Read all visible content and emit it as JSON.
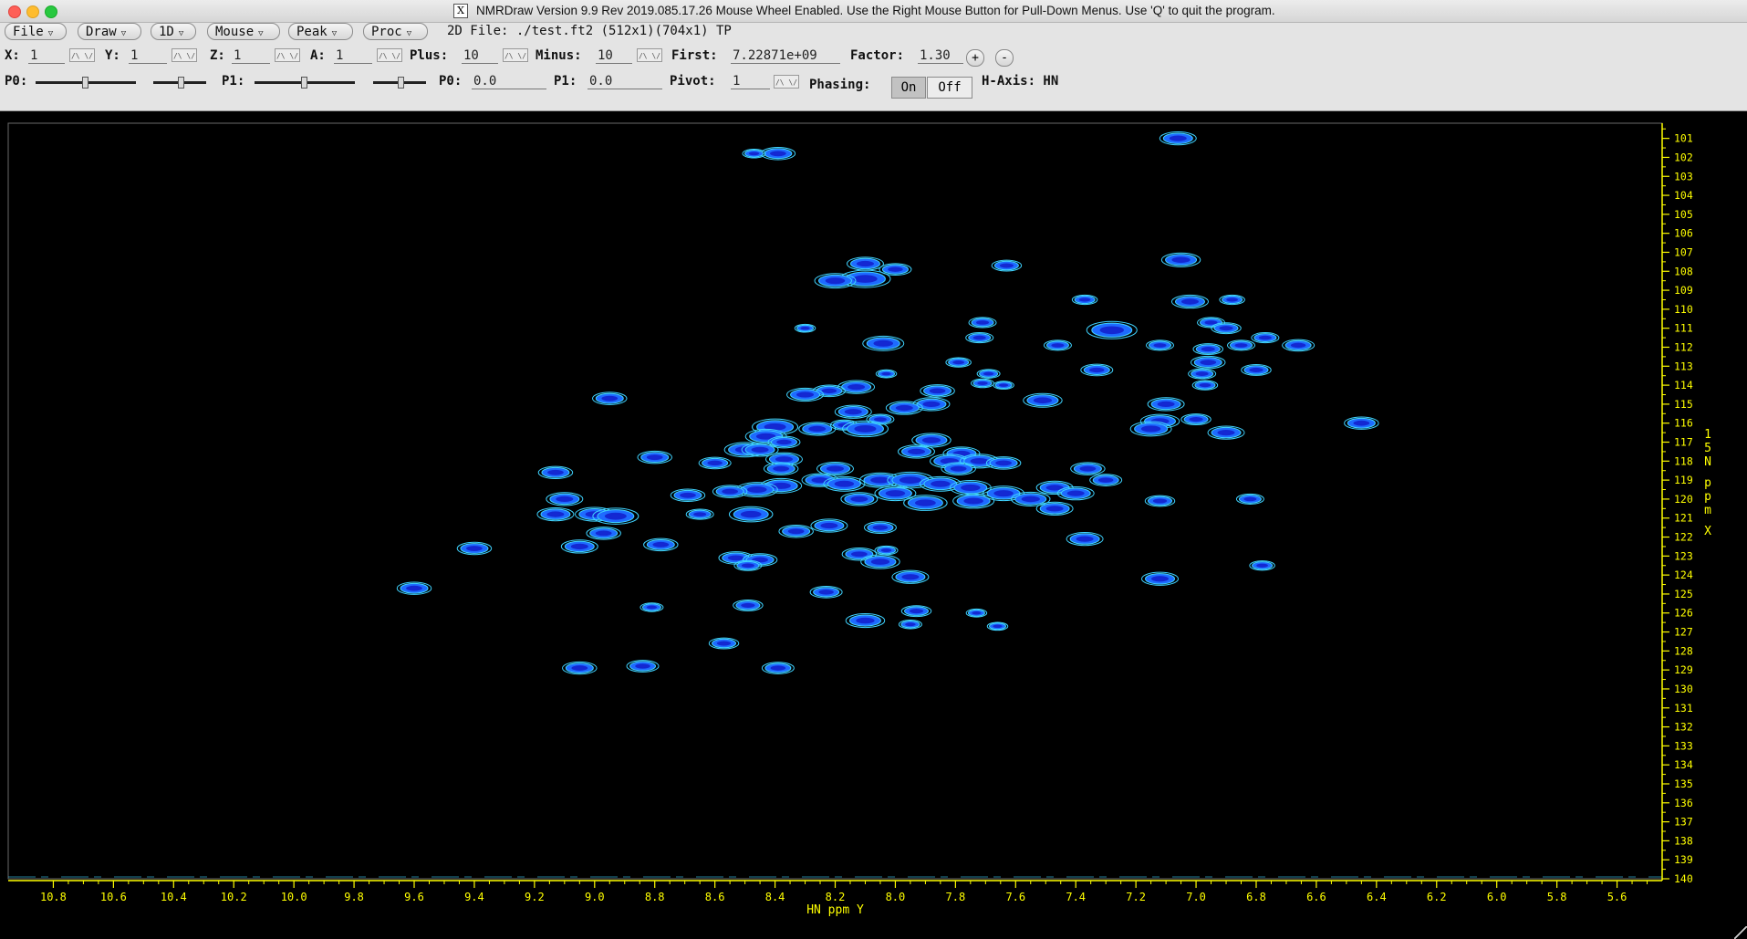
{
  "window": {
    "title": "NMRDraw Version 9.9 Rev 2019.085.17.26   Mouse Wheel Enabled.   Use the Right Mouse Button for Pull-Down Menus.   Use 'Q' to quit the program."
  },
  "menubar": {
    "file": "File",
    "draw": "Draw",
    "oned": "1D",
    "mouse": "Mouse",
    "peak": "Peak",
    "proc": "Proc",
    "file_info": "2D File: ./test.ft2 (512x1)(704x1) TP"
  },
  "row1": {
    "x_label": "X:",
    "x_value": "1",
    "y_label": "Y:",
    "y_value": "1",
    "z_label": "Z:",
    "z_value": "1",
    "a_label": "A:",
    "a_value": "1",
    "plus_label": "Plus:",
    "plus_value": "10",
    "minus_label": "Minus:",
    "minus_value": "10",
    "first_label": "First:",
    "first_value": "7.22871e+09",
    "factor_label": "Factor:",
    "factor_value": "1.30",
    "plus_btn": "+",
    "minus_btn": "-"
  },
  "row2": {
    "p0_slider_label": "P0:",
    "p1_slider_label": "P1:",
    "p0_label": "P0:",
    "p0_value": "0.0",
    "p1_label": "P1:",
    "p1_value": "0.0",
    "pivot_label": "Pivot:",
    "pivot_value": "1",
    "phasing_label": "Phasing:",
    "phasing_on": "On",
    "phasing_off": "Off",
    "haxis_label": "H-Axis: HN"
  },
  "colors": {
    "plot_bg": "#000000",
    "axis": "#ffff00",
    "contour_outer": "#3fd3ff",
    "contour_mid": "#1e6bff",
    "contour_inner": "#1428d2"
  },
  "chart_data": {
    "type": "scatter",
    "description_kind": "2D NMR contour plot (HSQC)",
    "xlabel": "HN ppm Y",
    "ylabel": "15N ppm X",
    "xlim": [
      10.95,
      5.45
    ],
    "ylim": [
      100.2,
      140.0
    ],
    "xticks": [
      "10.8",
      "10.6",
      "10.4",
      "10.2",
      "10.0",
      "9.8",
      "9.6",
      "9.4",
      "9.2",
      "9.0",
      "8.8",
      "8.6",
      "8.4",
      "8.2",
      "8.0",
      "7.8",
      "7.6",
      "7.4",
      "7.2",
      "7.0",
      "6.8",
      "6.6",
      "6.4",
      "6.2",
      "6.0",
      "5.8",
      "5.6"
    ],
    "yticks": [
      "101",
      "102",
      "103",
      "104",
      "105",
      "106",
      "107",
      "108",
      "109",
      "110",
      "111",
      "112",
      "113",
      "114",
      "115",
      "116",
      "117",
      "118",
      "119",
      "120",
      "121",
      "122",
      "123",
      "124",
      "125",
      "126",
      "127",
      "128",
      "129",
      "130",
      "131",
      "132",
      "133",
      "134",
      "135",
      "136",
      "137",
      "138",
      "139",
      "140"
    ],
    "peaks": [
      {
        "x": 7.06,
        "y": 101.0,
        "s": 1.0
      },
      {
        "x": 8.39,
        "y": 101.8,
        "s": 0.9
      },
      {
        "x": 8.47,
        "y": 101.8,
        "s": 0.4
      },
      {
        "x": 8.1,
        "y": 107.6,
        "s": 1.0
      },
      {
        "x": 8.0,
        "y": 107.9,
        "s": 0.8
      },
      {
        "x": 8.1,
        "y": 108.4,
        "s": 1.6
      },
      {
        "x": 8.2,
        "y": 108.5,
        "s": 1.2
      },
      {
        "x": 7.63,
        "y": 107.7,
        "s": 0.7
      },
      {
        "x": 7.05,
        "y": 107.4,
        "s": 1.1
      },
      {
        "x": 7.37,
        "y": 109.5,
        "s": 0.5
      },
      {
        "x": 7.02,
        "y": 109.6,
        "s": 1.0
      },
      {
        "x": 6.88,
        "y": 109.5,
        "s": 0.5
      },
      {
        "x": 7.71,
        "y": 110.7,
        "s": 0.6
      },
      {
        "x": 6.95,
        "y": 110.7,
        "s": 0.6
      },
      {
        "x": 7.28,
        "y": 111.1,
        "s": 1.6
      },
      {
        "x": 6.9,
        "y": 111.0,
        "s": 0.7
      },
      {
        "x": 8.04,
        "y": 111.8,
        "s": 1.2
      },
      {
        "x": 7.72,
        "y": 111.5,
        "s": 0.6
      },
      {
        "x": 7.46,
        "y": 111.9,
        "s": 0.6
      },
      {
        "x": 7.12,
        "y": 111.9,
        "s": 0.6
      },
      {
        "x": 6.96,
        "y": 112.1,
        "s": 0.7
      },
      {
        "x": 6.85,
        "y": 111.9,
        "s": 0.6
      },
      {
        "x": 6.77,
        "y": 111.5,
        "s": 0.6
      },
      {
        "x": 6.66,
        "y": 111.9,
        "s": 0.8
      },
      {
        "x": 7.79,
        "y": 112.8,
        "s": 0.5
      },
      {
        "x": 6.96,
        "y": 112.8,
        "s": 0.9
      },
      {
        "x": 7.33,
        "y": 113.2,
        "s": 0.8
      },
      {
        "x": 6.98,
        "y": 113.4,
        "s": 0.6
      },
      {
        "x": 6.8,
        "y": 113.2,
        "s": 0.7
      },
      {
        "x": 7.69,
        "y": 113.4,
        "s": 0.4
      },
      {
        "x": 8.3,
        "y": 111.0,
        "s": 0.3
      },
      {
        "x": 8.03,
        "y": 113.4,
        "s": 0.3
      },
      {
        "x": 8.13,
        "y": 114.1,
        "s": 1.0
      },
      {
        "x": 8.22,
        "y": 114.3,
        "s": 0.8
      },
      {
        "x": 8.3,
        "y": 114.5,
        "s": 1.0
      },
      {
        "x": 7.71,
        "y": 113.9,
        "s": 0.4
      },
      {
        "x": 7.64,
        "y": 114.0,
        "s": 0.3
      },
      {
        "x": 6.97,
        "y": 114.0,
        "s": 0.5
      },
      {
        "x": 7.86,
        "y": 114.3,
        "s": 0.9
      },
      {
        "x": 8.95,
        "y": 114.7,
        "s": 0.9
      },
      {
        "x": 7.51,
        "y": 114.8,
        "s": 1.1
      },
      {
        "x": 7.1,
        "y": 115.0,
        "s": 1.0
      },
      {
        "x": 7.88,
        "y": 115.0,
        "s": 1.0
      },
      {
        "x": 7.97,
        "y": 115.2,
        "s": 1.0
      },
      {
        "x": 8.14,
        "y": 115.4,
        "s": 1.0
      },
      {
        "x": 8.05,
        "y": 115.8,
        "s": 0.6
      },
      {
        "x": 8.17,
        "y": 116.1,
        "s": 0.6
      },
      {
        "x": 8.4,
        "y": 116.2,
        "s": 1.4
      },
      {
        "x": 8.26,
        "y": 116.3,
        "s": 1.0
      },
      {
        "x": 8.1,
        "y": 116.3,
        "s": 1.4
      },
      {
        "x": 7.12,
        "y": 115.9,
        "s": 1.1
      },
      {
        "x": 7.0,
        "y": 115.8,
        "s": 0.7
      },
      {
        "x": 6.45,
        "y": 116.0,
        "s": 0.9
      },
      {
        "x": 7.15,
        "y": 116.3,
        "s": 1.2
      },
      {
        "x": 6.9,
        "y": 116.5,
        "s": 1.0
      },
      {
        "x": 8.43,
        "y": 116.7,
        "s": 1.2
      },
      {
        "x": 8.37,
        "y": 117.0,
        "s": 0.8
      },
      {
        "x": 8.5,
        "y": 117.4,
        "s": 1.2
      },
      {
        "x": 8.45,
        "y": 117.4,
        "s": 1.0
      },
      {
        "x": 7.88,
        "y": 116.9,
        "s": 1.1
      },
      {
        "x": 7.93,
        "y": 117.5,
        "s": 1.0
      },
      {
        "x": 7.78,
        "y": 117.6,
        "s": 1.0
      },
      {
        "x": 7.82,
        "y": 118.0,
        "s": 1.1
      },
      {
        "x": 7.72,
        "y": 118.0,
        "s": 1.1
      },
      {
        "x": 7.64,
        "y": 118.1,
        "s": 0.9
      },
      {
        "x": 8.8,
        "y": 117.8,
        "s": 0.9
      },
      {
        "x": 8.6,
        "y": 118.1,
        "s": 0.8
      },
      {
        "x": 8.37,
        "y": 117.9,
        "s": 1.0
      },
      {
        "x": 8.38,
        "y": 118.4,
        "s": 0.9
      },
      {
        "x": 8.2,
        "y": 118.4,
        "s": 1.0
      },
      {
        "x": 9.13,
        "y": 118.6,
        "s": 0.9
      },
      {
        "x": 7.79,
        "y": 118.4,
        "s": 0.9
      },
      {
        "x": 7.36,
        "y": 118.4,
        "s": 0.9
      },
      {
        "x": 7.3,
        "y": 119.0,
        "s": 0.8
      },
      {
        "x": 8.38,
        "y": 119.3,
        "s": 1.2
      },
      {
        "x": 8.46,
        "y": 119.5,
        "s": 1.2
      },
      {
        "x": 8.25,
        "y": 119.0,
        "s": 1.0
      },
      {
        "x": 8.17,
        "y": 119.2,
        "s": 1.2
      },
      {
        "x": 8.05,
        "y": 119.0,
        "s": 1.2
      },
      {
        "x": 7.95,
        "y": 119.0,
        "s": 1.4
      },
      {
        "x": 7.85,
        "y": 119.2,
        "s": 1.2
      },
      {
        "x": 7.75,
        "y": 119.4,
        "s": 1.2
      },
      {
        "x": 7.64,
        "y": 119.7,
        "s": 1.2
      },
      {
        "x": 7.55,
        "y": 120.0,
        "s": 1.1
      },
      {
        "x": 7.47,
        "y": 119.4,
        "s": 1.0
      },
      {
        "x": 7.4,
        "y": 119.7,
        "s": 1.0
      },
      {
        "x": 8.69,
        "y": 119.8,
        "s": 0.9
      },
      {
        "x": 8.55,
        "y": 119.6,
        "s": 0.9
      },
      {
        "x": 8.0,
        "y": 119.7,
        "s": 1.2
      },
      {
        "x": 8.12,
        "y": 120.0,
        "s": 1.0
      },
      {
        "x": 7.9,
        "y": 120.2,
        "s": 1.3
      },
      {
        "x": 7.74,
        "y": 120.1,
        "s": 1.2
      },
      {
        "x": 7.47,
        "y": 120.5,
        "s": 1.0
      },
      {
        "x": 7.12,
        "y": 120.1,
        "s": 0.7
      },
      {
        "x": 6.82,
        "y": 120.0,
        "s": 0.6
      },
      {
        "x": 9.1,
        "y": 120.0,
        "s": 1.0
      },
      {
        "x": 9.13,
        "y": 120.8,
        "s": 1.0
      },
      {
        "x": 9.0,
        "y": 120.8,
        "s": 1.1
      },
      {
        "x": 8.93,
        "y": 120.9,
        "s": 1.4
      },
      {
        "x": 8.65,
        "y": 120.8,
        "s": 0.6
      },
      {
        "x": 8.48,
        "y": 120.8,
        "s": 1.3
      },
      {
        "x": 8.22,
        "y": 121.4,
        "s": 1.0
      },
      {
        "x": 8.33,
        "y": 121.7,
        "s": 0.9
      },
      {
        "x": 8.05,
        "y": 121.5,
        "s": 0.8
      },
      {
        "x": 8.97,
        "y": 121.8,
        "s": 0.9
      },
      {
        "x": 9.05,
        "y": 122.5,
        "s": 1.0
      },
      {
        "x": 8.78,
        "y": 122.4,
        "s": 0.9
      },
      {
        "x": 9.4,
        "y": 122.6,
        "s": 0.9
      },
      {
        "x": 7.37,
        "y": 122.1,
        "s": 1.0
      },
      {
        "x": 8.12,
        "y": 122.9,
        "s": 0.9
      },
      {
        "x": 8.03,
        "y": 122.7,
        "s": 0.4
      },
      {
        "x": 8.53,
        "y": 123.1,
        "s": 0.9
      },
      {
        "x": 8.45,
        "y": 123.2,
        "s": 0.9
      },
      {
        "x": 8.49,
        "y": 123.5,
        "s": 0.6
      },
      {
        "x": 8.05,
        "y": 123.3,
        "s": 1.1
      },
      {
        "x": 7.95,
        "y": 124.1,
        "s": 1.0
      },
      {
        "x": 7.12,
        "y": 124.2,
        "s": 1.0
      },
      {
        "x": 6.78,
        "y": 123.5,
        "s": 0.5
      },
      {
        "x": 9.6,
        "y": 124.7,
        "s": 0.9
      },
      {
        "x": 8.23,
        "y": 124.9,
        "s": 0.8
      },
      {
        "x": 8.49,
        "y": 125.6,
        "s": 0.7
      },
      {
        "x": 8.81,
        "y": 125.7,
        "s": 0.4
      },
      {
        "x": 7.93,
        "y": 125.9,
        "s": 0.7
      },
      {
        "x": 8.1,
        "y": 126.4,
        "s": 1.1
      },
      {
        "x": 7.73,
        "y": 126.0,
        "s": 0.3
      },
      {
        "x": 7.95,
        "y": 126.6,
        "s": 0.4
      },
      {
        "x": 7.66,
        "y": 126.7,
        "s": 0.3
      },
      {
        "x": 8.57,
        "y": 127.6,
        "s": 0.7
      },
      {
        "x": 9.05,
        "y": 128.9,
        "s": 0.9
      },
      {
        "x": 8.84,
        "y": 128.8,
        "s": 0.8
      },
      {
        "x": 8.39,
        "y": 128.9,
        "s": 0.8
      }
    ]
  }
}
